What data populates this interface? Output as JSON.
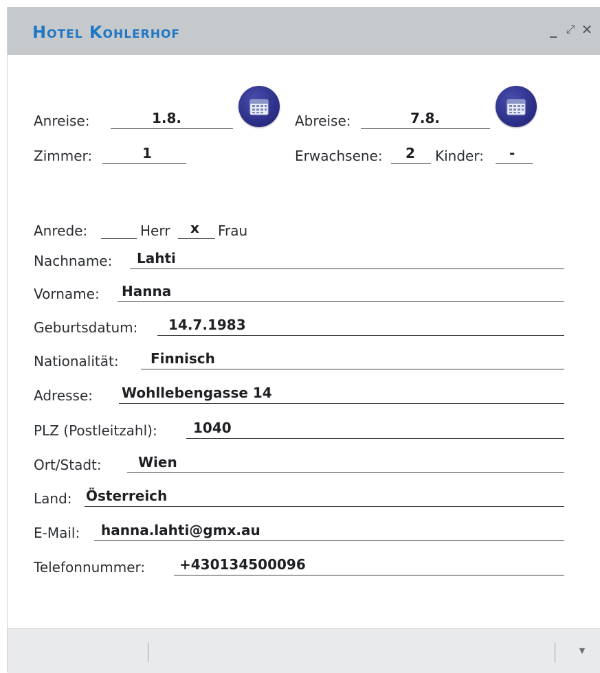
{
  "window": {
    "title": "Hotel Kohlerhof",
    "controls": {
      "minimize": "_",
      "maximize": "⤢",
      "close": "✕"
    }
  },
  "booking": {
    "arrival_label": "Anreise:",
    "arrival_value": "1.8.",
    "departure_label": "Abreise:",
    "departure_value": "7.8.",
    "rooms_label": "Zimmer:",
    "rooms_value": "1",
    "adults_label": "Erwachsene:",
    "adults_value": "2",
    "children_label": "Kinder:",
    "children_value": "-"
  },
  "salutation": {
    "label": "Anrede:",
    "herr_label": "Herr",
    "herr_value": "",
    "frau_label": "Frau",
    "frau_value": "x"
  },
  "fields": {
    "lastname_label": "Nachname:",
    "lastname_value": "Lahti",
    "firstname_label": "Vorname:",
    "firstname_value": "Hanna",
    "birthdate_label": "Geburtsdatum:",
    "birthdate_value": "14.7.1983",
    "nationality_label": "Nationalität:",
    "nationality_value": "Finnisch",
    "address_label": "Adresse:",
    "address_value": "Wohllebengasse 14",
    "zip_label": "PLZ (Postleitzahl):",
    "zip_value": "1040",
    "city_label": "Ort/Stadt:",
    "city_value": "Wien",
    "country_label": "Land:",
    "country_value": "Österreich",
    "email_label": "E-Mail:",
    "email_value": "hanna.lahti@gmx.au",
    "phone_label": "Telefonnummer:",
    "phone_value": "+430134500096"
  },
  "icons": {
    "calendar": "calendar-icon",
    "footer_dropdown": "chevron-down-icon"
  },
  "colors": {
    "title": "#1f77c4",
    "titlebar": "#c6c9cc",
    "calendar_button": "#2d3088"
  }
}
